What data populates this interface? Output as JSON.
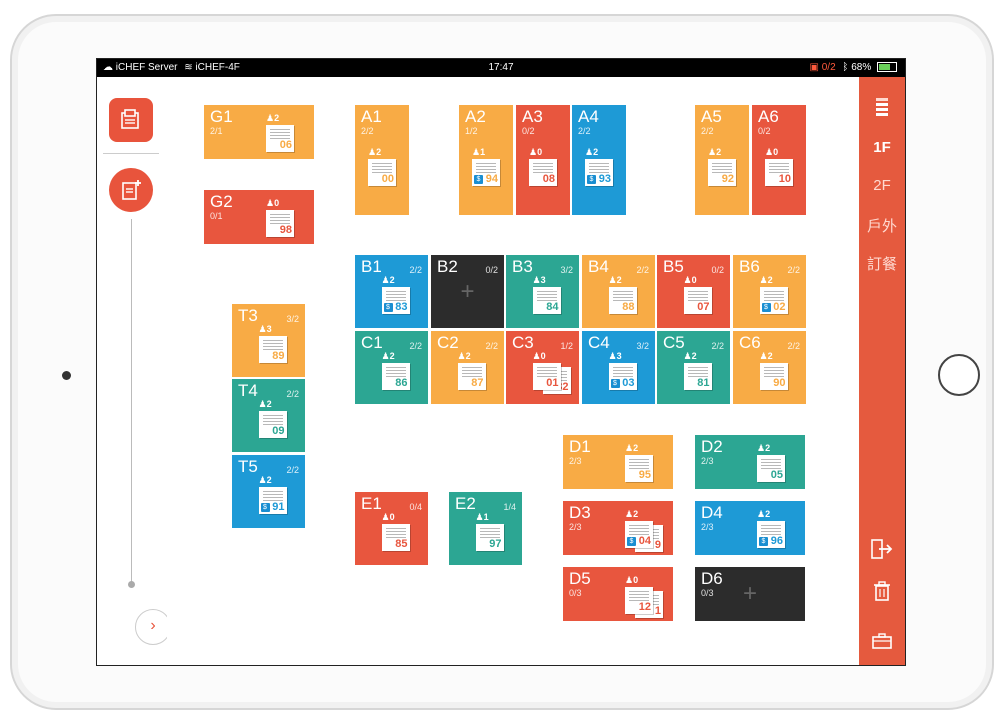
{
  "status": {
    "carrier": "iCHEF Server",
    "wifi": "iCHEF-4F",
    "time": "17:47",
    "printer": "0/2",
    "battery": "68%"
  },
  "floors": [
    "1F",
    "2F",
    "戶外",
    "訂餐"
  ],
  "colors": {
    "orange": "#f8ab45",
    "red": "#e8563e",
    "teal": "#2ca693",
    "blue": "#1e9ad6",
    "dark": "#2c2c2c"
  },
  "tables": [
    {
      "name": "G1",
      "cap": "2/1",
      "color": "orange",
      "guests": "2",
      "order": "06"
    },
    {
      "name": "G2",
      "cap": "0/1",
      "color": "red",
      "guests": "0",
      "order": "98"
    },
    {
      "name": "A1",
      "cap": "2/2",
      "color": "orange",
      "guests": "2",
      "order": "00"
    },
    {
      "name": "A2",
      "cap": "1/2",
      "color": "orange",
      "guests": "1",
      "order": "94",
      "paid": true
    },
    {
      "name": "A3",
      "cap": "0/2",
      "color": "red",
      "guests": "0",
      "order": "08"
    },
    {
      "name": "A4",
      "cap": "2/2",
      "color": "blue",
      "guests": "2",
      "order": "93",
      "paid": true
    },
    {
      "name": "A5",
      "cap": "2/2",
      "color": "orange",
      "guests": "2",
      "order": "92"
    },
    {
      "name": "A6",
      "cap": "0/2",
      "color": "red",
      "guests": "0",
      "order": "10"
    },
    {
      "name": "B1",
      "cap": "2/2",
      "color": "blue",
      "guests": "2",
      "order": "83",
      "paid": true
    },
    {
      "name": "B2",
      "cap": "0/2",
      "color": "dark",
      "empty": true
    },
    {
      "name": "B3",
      "cap": "3/2",
      "color": "teal",
      "guests": "3",
      "order": "84"
    },
    {
      "name": "B4",
      "cap": "2/2",
      "color": "orange",
      "guests": "2",
      "order": "88"
    },
    {
      "name": "B5",
      "cap": "0/2",
      "color": "red",
      "guests": "0",
      "order": "07"
    },
    {
      "name": "B6",
      "cap": "2/2",
      "color": "orange",
      "guests": "2",
      "order": "02",
      "paid": true
    },
    {
      "name": "C1",
      "cap": "2/2",
      "color": "teal",
      "guests": "2",
      "order": "86"
    },
    {
      "name": "C2",
      "cap": "2/2",
      "color": "orange",
      "guests": "2",
      "order": "87"
    },
    {
      "name": "C3",
      "cap": "1/2",
      "color": "red",
      "guests": "0",
      "order": "01",
      "order2": "82"
    },
    {
      "name": "C4",
      "cap": "3/2",
      "color": "blue",
      "guests": "3",
      "order": "03",
      "paid": true
    },
    {
      "name": "C5",
      "cap": "2/2",
      "color": "teal",
      "guests": "2",
      "order": "81"
    },
    {
      "name": "C6",
      "cap": "2/2",
      "color": "orange",
      "guests": "2",
      "order": "90"
    },
    {
      "name": "T3",
      "cap": "3/2",
      "color": "orange",
      "guests": "3",
      "order": "89"
    },
    {
      "name": "T4",
      "cap": "2/2",
      "color": "teal",
      "guests": "2",
      "order": "09"
    },
    {
      "name": "T5",
      "cap": "2/2",
      "color": "blue",
      "guests": "2",
      "order": "91",
      "paid": true
    },
    {
      "name": "D1",
      "cap": "2/3",
      "color": "orange",
      "guests": "2",
      "order": "95"
    },
    {
      "name": "D2",
      "cap": "2/3",
      "color": "teal",
      "guests": "2",
      "order": "05"
    },
    {
      "name": "D3",
      "cap": "2/3",
      "color": "red",
      "guests": "2",
      "order": "04",
      "order2": "9",
      "paid": true
    },
    {
      "name": "D4",
      "cap": "2/3",
      "color": "blue",
      "guests": "2",
      "order": "96",
      "paid": true
    },
    {
      "name": "D5",
      "cap": "0/3",
      "color": "red",
      "guests": "0",
      "order": "12",
      "order2": "1"
    },
    {
      "name": "D6",
      "cap": "0/3",
      "color": "dark",
      "empty": true
    },
    {
      "name": "E1",
      "cap": "0/4",
      "color": "red",
      "guests": "0",
      "order": "85"
    },
    {
      "name": "E2",
      "cap": "1/4",
      "color": "teal",
      "guests": "1",
      "order": "97"
    }
  ]
}
